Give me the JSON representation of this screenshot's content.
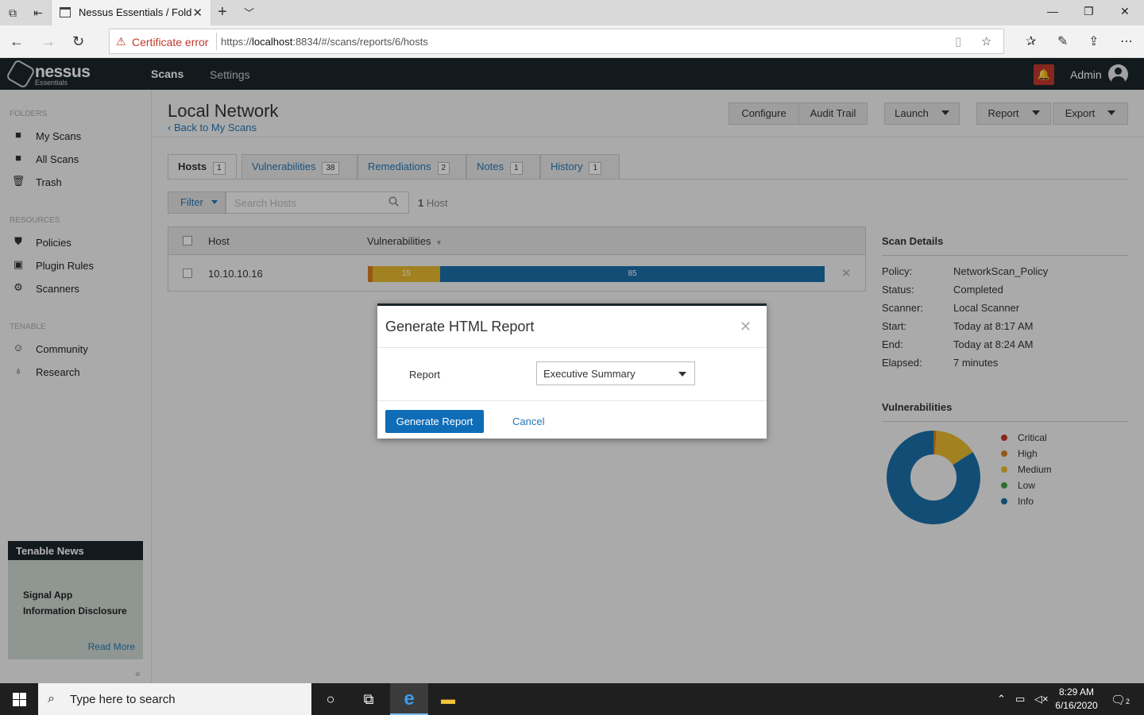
{
  "browser": {
    "tab_title": "Nessus Essentials / Fold",
    "cert_error": "Certificate error",
    "url_prefix": "https://",
    "url_host": "localhost",
    "url_rest": ":8834/#/scans/reports/6/hosts"
  },
  "app": {
    "logo_text": "nessus",
    "logo_sub": "Essentials",
    "nav": {
      "scans": "Scans",
      "settings": "Settings"
    },
    "user": "Admin"
  },
  "sidebar": {
    "folders_heading": "FOLDERS",
    "folders": [
      {
        "label": "My Scans",
        "icon": "folder-icon"
      },
      {
        "label": "All Scans",
        "icon": "folder-icon"
      },
      {
        "label": "Trash",
        "icon": "trash-icon"
      }
    ],
    "resources_heading": "RESOURCES",
    "resources": [
      {
        "label": "Policies",
        "icon": "shield-icon"
      },
      {
        "label": "Plugin Rules",
        "icon": "plugin-icon"
      },
      {
        "label": "Scanners",
        "icon": "scanner-icon"
      }
    ],
    "tenable_heading": "TENABLE",
    "tenable": [
      {
        "label": "Community",
        "icon": "community-icon"
      },
      {
        "label": "Research",
        "icon": "lightbulb-icon"
      }
    ],
    "news": {
      "heading": "Tenable News",
      "title_line1": "Signal App",
      "title_line2": "Information Disclosure",
      "read_more": "Read More"
    }
  },
  "main": {
    "title": "Local Network",
    "back_link": "Back to My Scans",
    "buttons": {
      "configure": "Configure",
      "audit_trail": "Audit Trail",
      "launch": "Launch",
      "report": "Report",
      "export": "Export"
    },
    "tabs": [
      {
        "label": "Hosts",
        "count": "1"
      },
      {
        "label": "Vulnerabilities",
        "count": "38"
      },
      {
        "label": "Remediations",
        "count": "2"
      },
      {
        "label": "Notes",
        "count": "1"
      },
      {
        "label": "History",
        "count": "1"
      }
    ],
    "filter_label": "Filter",
    "search_placeholder": "Search Hosts",
    "host_count_num": "1",
    "host_count_label": "Host",
    "table": {
      "col_host": "Host",
      "col_vulns": "Vulnerabilities",
      "rows": [
        {
          "host": "10.10.10.16",
          "high": 1,
          "medium": 15,
          "info": 85,
          "medium_label": "15",
          "info_label": "85"
        }
      ]
    },
    "scan_details": {
      "heading": "Scan Details",
      "items": [
        {
          "label": "Policy:",
          "value": "NetworkScan_Policy"
        },
        {
          "label": "Status:",
          "value": "Completed"
        },
        {
          "label": "Scanner:",
          "value": "Local Scanner"
        },
        {
          "label": "Start:",
          "value": "Today at 8:17 AM"
        },
        {
          "label": "End:",
          "value": "Today at 8:24 AM"
        },
        {
          "label": "Elapsed:",
          "value": "7 minutes"
        }
      ]
    },
    "vulnerabilities": {
      "heading": "Vulnerabilities",
      "legend": [
        {
          "label": "Critical",
          "color": "#c0392b"
        },
        {
          "label": "High",
          "color": "#d77e22"
        },
        {
          "label": "Medium",
          "color": "#e9b930"
        },
        {
          "label": "Low",
          "color": "#43a047"
        },
        {
          "label": "Info",
          "color": "#1a6fa8"
        }
      ],
      "donut_values": {
        "critical": 0,
        "high": 1,
        "medium": 15,
        "low": 0,
        "info": 85
      }
    }
  },
  "modal": {
    "title": "Generate HTML Report",
    "report_label": "Report",
    "report_selected": "Executive Summary",
    "generate_button": "Generate Report",
    "cancel": "Cancel"
  },
  "taskbar": {
    "search_placeholder": "Type here to search",
    "time": "8:29 AM",
    "date": "6/16/2020",
    "notification_count": "2"
  },
  "colors": {
    "header_bg": "#1b262b",
    "link": "#2577b5",
    "primary_button": "#0f6db8"
  }
}
